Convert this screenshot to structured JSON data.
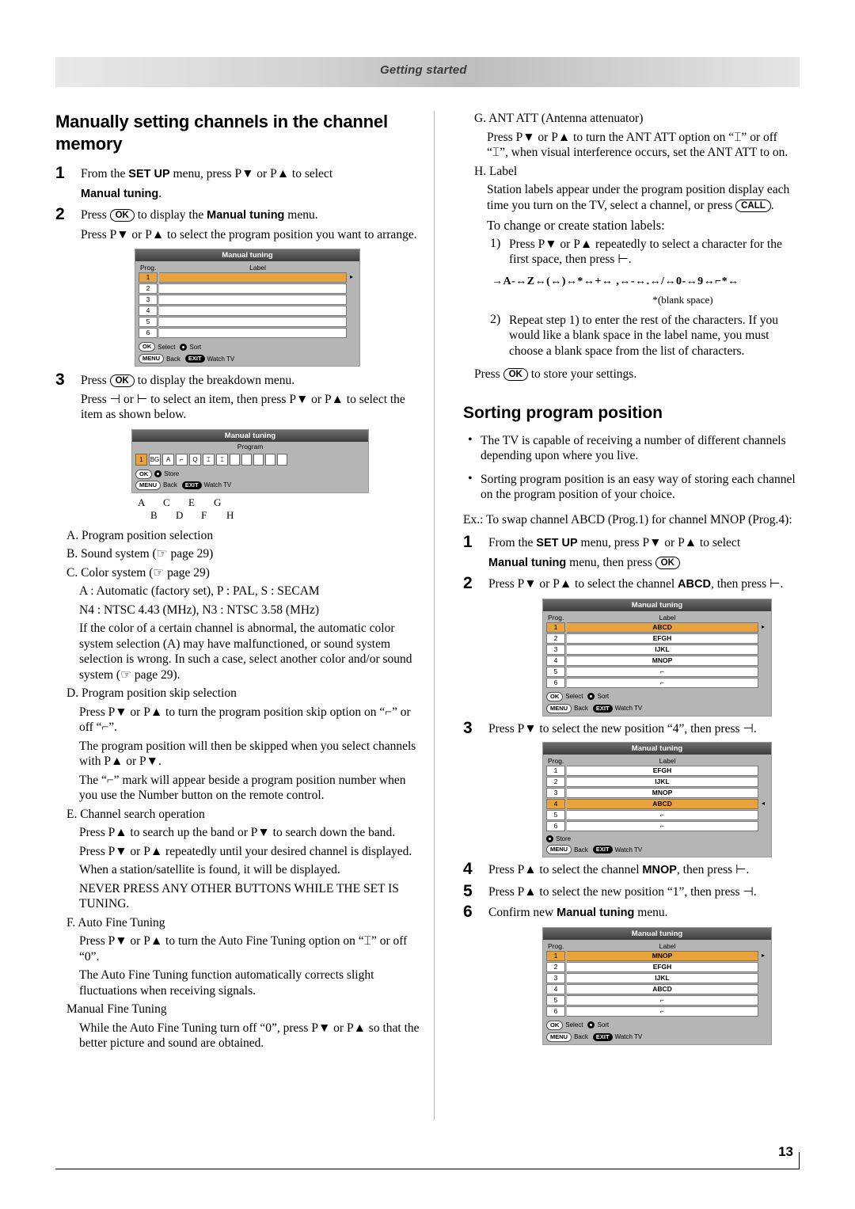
{
  "header": {
    "title": "Getting started"
  },
  "page_number": "13",
  "left": {
    "heading": "Manually setting channels in the channel memory",
    "step1": {
      "num": "1",
      "text_a": "From the ",
      "bold_setup": "SET UP",
      "text_b": " menu, press P▼ or P▲ to select",
      "bold_manual": "Manual tuning",
      "text_c": "."
    },
    "step2": {
      "num": "2",
      "t1": "Press ",
      "key_ok": "OK",
      "t2": " to display the ",
      "bold": "Manual tuning",
      "t3": " menu.",
      "t4": "Press P▼ or P▲ to select the program position you want to arrange."
    },
    "osd1": {
      "title": "Manual tuning",
      "col_prog": "Prog.",
      "col_label": "Label",
      "rows": [
        "1",
        "2",
        "3",
        "4",
        "5",
        "6"
      ],
      "footer": [
        {
          "key": "OK",
          "label": "Select"
        },
        {
          "key": "dot",
          "label": "Sort"
        },
        {
          "key": "MENU",
          "label": "Back"
        },
        {
          "key": "EXIT",
          "label": "Watch TV"
        }
      ]
    },
    "step3": {
      "num": "3",
      "t1": "Press ",
      "key_ok": "OK",
      "t2": " to display the breakdown menu.",
      "t3": "Press ⊣ or ⊢ to select an item, then press P▼ or P▲ to select the item as shown below."
    },
    "osd2": {
      "title": "Manual tuning",
      "subtitle": "Program",
      "cells": [
        "1",
        "BG",
        "A",
        "",
        "0",
        "",
        "",
        ""
      ],
      "footer": [
        {
          "key": "OK",
          "label": "Store"
        },
        {
          "key": "MENU",
          "label": "Back"
        },
        {
          "key": "EXIT",
          "label": "Watch TV"
        }
      ],
      "letters_top": [
        "A",
        "C",
        "E",
        "G"
      ],
      "letters_bot": [
        "B",
        "D",
        "F",
        "H"
      ]
    },
    "items": {
      "a": "A. Program position selection",
      "b": "B. Sound system (☞ page 29)",
      "c": "C. Color system (☞ page 29)",
      "c1": "A : Automatic (factory set), P : PAL, S : SECAM",
      "c2": "N4 : NTSC 4.43 (MHz), N3 : NTSC 3.58 (MHz)",
      "c3": "If the color of a certain channel is abnormal, the automatic color system selection (A) may have malfunctioned, or sound system selection is wrong. In such a case, select another color and/or sound system (☞ page 29).",
      "d": "D. Program position skip selection",
      "d1": "Press P▼ or P▲ to turn the program position skip option on “⌐” or off “⌐”.",
      "d2": "The program position will then be skipped when you select channels with P▲ or P▼.",
      "d3": "The “⌐” mark will appear beside a program position number when you use the Number button on the remote control.",
      "d3_bold": "Number",
      "e": "E. Channel search operation",
      "e1": "Press P▲ to search up the band or P▼ to search down the band.",
      "e2": "Press P▼ or P▲ repeatedly until your desired channel is displayed.",
      "e3": "When a station/satellite is found, it will be displayed.",
      "e4": "NEVER PRESS ANY OTHER BUTTONS WHILE THE SET IS TUNING.",
      "f": "F. Auto Fine Tuning",
      "f1": "Press P▼ or P▲ to turn the Auto Fine Tuning option on “⌶” or off “0”.",
      "f2": "The Auto Fine Tuning function automatically corrects slight fluctuations when receiving signals.",
      "g": "Manual Fine Tuning",
      "g1": "While the Auto Fine Tuning turn off “0”, press P▼ or P▲ so that the better picture and sound are obtained."
    }
  },
  "right": {
    "g": "G. ANT ATT (Antenna attenuator)",
    "g1": "Press P▼ or P▲ to turn the ANT ATT option on “⌶” or off “⌶”, when visual interference occurs, set the ANT ATT to on.",
    "h": "H. Label",
    "h1": "Station labels appear under the program position display each time you turn on the TV, select a channel, or press ",
    "h1_key": "CALL",
    "h1_end": ".",
    "h2": "To change or create station labels:",
    "h3_num": "1)",
    "h3": "Press P▼ or P▲ repeatedly to select a character for the first space, then press ⊢.",
    "charline": "→A-↔Z↔(↔)↔*↔+↔ ,↔-↔.↔/↔0-↔9↔⌐*↔",
    "blanknote": "*(blank space)",
    "h4_num": "2)",
    "h4": "Repeat step 1) to enter the rest of the characters. If you would like a blank space in the label name, you must choose a blank space from the list of characters.",
    "h5_a": "Press ",
    "h5_key": "OK",
    "h5_b": " to store your settings.",
    "sorting_heading": "Sorting program position",
    "bullets": [
      "The TV is capable of receiving a number of different channels depending upon where you live.",
      "Sorting program position is an easy way of storing each channel on the program position of your choice."
    ],
    "example": "Ex.: To swap channel ABCD (Prog.1) for channel MNOP (Prog.4):",
    "s1": {
      "num": "1",
      "t1": "From the ",
      "b1": "SET UP",
      "t2": " menu, press P▼ or P▲ to select ",
      "b2": "Manual tuning",
      "t3": " menu, then press ",
      "key": "OK"
    },
    "s2": {
      "num": "2",
      "t1": "Press P▼ or P▲ to select the channel ",
      "b1": "ABCD",
      "t2": ", then press ⊢."
    },
    "osd_a": {
      "title": "Manual tuning",
      "col_prog": "Prog.",
      "col_label": "Label",
      "rows": [
        {
          "n": "1",
          "label": "ABCD",
          "sel": true,
          "mark": "▸"
        },
        {
          "n": "2",
          "label": "EFGH",
          "sel": false,
          "mark": ""
        },
        {
          "n": "3",
          "label": "IJKL",
          "sel": false,
          "mark": ""
        },
        {
          "n": "4",
          "label": "MNOP",
          "sel": false,
          "mark": ""
        },
        {
          "n": "5",
          "label": "⌐",
          "sel": false,
          "mark": ""
        },
        {
          "n": "6",
          "label": "⌐",
          "sel": false,
          "mark": ""
        }
      ],
      "footer": [
        {
          "key": "OK",
          "label": "Select"
        },
        {
          "key": "dot",
          "label": "Sort"
        },
        {
          "key": "MENU",
          "label": "Back"
        },
        {
          "key": "EXIT",
          "label": "Watch TV"
        }
      ]
    },
    "s3": {
      "num": "3",
      "t1": "Press P▼ to select the new position “4”, then press ⊣."
    },
    "osd_b": {
      "title": "Manual tuning",
      "col_prog": "Prog.",
      "col_label": "Label",
      "rows": [
        {
          "n": "1",
          "label": "EFGH",
          "sel": false,
          "mark": ""
        },
        {
          "n": "2",
          "label": "IJKL",
          "sel": false,
          "mark": ""
        },
        {
          "n": "3",
          "label": "MNOP",
          "sel": false,
          "mark": ""
        },
        {
          "n": "4",
          "label": "ABCD",
          "sel": true,
          "mark": "◂"
        },
        {
          "n": "5",
          "label": "⌐",
          "sel": false,
          "mark": ""
        },
        {
          "n": "6",
          "label": "⌐",
          "sel": false,
          "mark": ""
        }
      ],
      "footer": [
        {
          "key": "dot",
          "label": "Store"
        },
        {
          "key": "MENU",
          "label": "Back"
        },
        {
          "key": "EXIT",
          "label": "Watch TV"
        }
      ]
    },
    "s4": {
      "num": "4",
      "t1": "Press P▲ to select the channel ",
      "b1": "MNOP",
      "t2": ", then press ⊢."
    },
    "s5": {
      "num": "5",
      "t1": "Press P▲ to select the new position “1”, then press ⊣."
    },
    "s6": {
      "num": "6",
      "t1": "Confirm new ",
      "b1": "Manual tuning",
      "t2": " menu."
    },
    "osd_c": {
      "title": "Manual tuning",
      "col_prog": "Prog.",
      "col_label": "Label",
      "rows": [
        {
          "n": "1",
          "label": "MNOP",
          "sel": true,
          "mark": "▸"
        },
        {
          "n": "2",
          "label": "EFGH",
          "sel": false,
          "mark": ""
        },
        {
          "n": "3",
          "label": "IJKL",
          "sel": false,
          "mark": ""
        },
        {
          "n": "4",
          "label": "ABCD",
          "sel": false,
          "mark": ""
        },
        {
          "n": "5",
          "label": "⌐",
          "sel": false,
          "mark": ""
        },
        {
          "n": "6",
          "label": "⌐",
          "sel": false,
          "mark": ""
        }
      ],
      "footer": [
        {
          "key": "OK",
          "label": "Select"
        },
        {
          "key": "dot",
          "label": "Sort"
        },
        {
          "key": "MENU",
          "label": "Back"
        },
        {
          "key": "EXIT",
          "label": "Watch TV"
        }
      ]
    }
  }
}
